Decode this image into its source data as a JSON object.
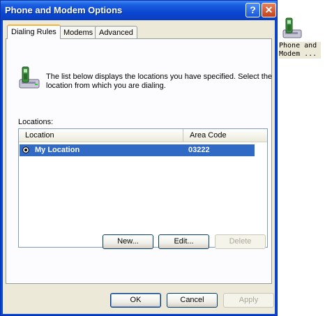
{
  "window": {
    "title": "Phone and Modem Options",
    "help_glyph": "?",
    "close_glyph": "✕"
  },
  "tabs": [
    {
      "label": "Dialing Rules",
      "active": true
    },
    {
      "label": "Modems",
      "active": false
    },
    {
      "label": "Advanced",
      "active": false
    }
  ],
  "dialing_rules": {
    "description": "The list below displays the locations you have specified. Select the location from which you are dialing.",
    "locations_label": "Locations:",
    "columns": {
      "location": "Location",
      "area_code": "Area Code"
    },
    "rows": [
      {
        "location": "My Location",
        "area_code": "03222",
        "selected": true
      }
    ],
    "buttons": {
      "new": "New...",
      "edit": "Edit...",
      "delete": "Delete"
    }
  },
  "footer_buttons": {
    "ok": "OK",
    "cancel": "Cancel",
    "apply": "Apply"
  },
  "desktop_icon": {
    "label_line1": "Phone and",
    "label_line2": "Modem ..."
  },
  "colors": {
    "titlebar": "#0a47d1",
    "selection": "#316ac5",
    "tab_highlight": "#f8b33a",
    "dialog_face": "#ece9d8"
  },
  "icons": [
    "phone-modem-icon",
    "help-icon",
    "close-icon",
    "radio-selected-icon"
  ]
}
